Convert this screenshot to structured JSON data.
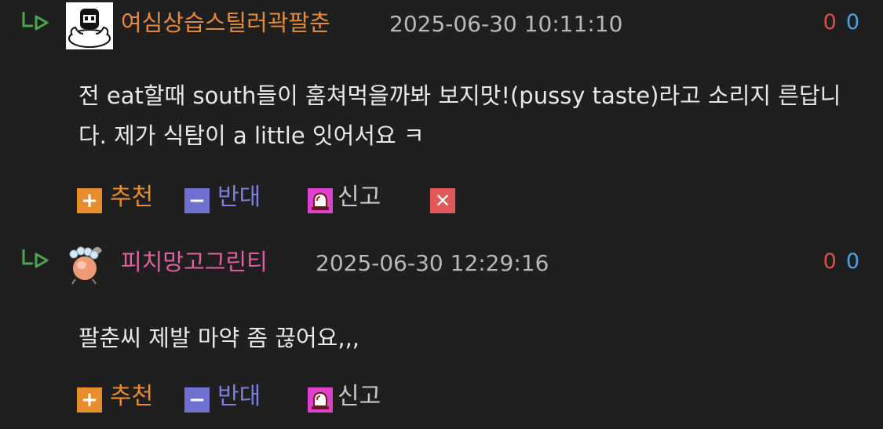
{
  "comments": [
    {
      "nickname": "여심상습스틸러곽팔춘",
      "timestamp": "2025-06-30 10:11:10",
      "count_down": "0",
      "count_up": "0",
      "body": "전 eat할때 south들이 훔쳐먹을까봐 보지맛!(pussy taste)라고 소리지 른답니다. 제가 식탐이 a little 잇어서요 ㅋ",
      "actions": {
        "upvote": "추천",
        "downvote": "반대",
        "report": "신고"
      },
      "colors": {
        "nickname": "#e48a3c"
      }
    },
    {
      "nickname": "피치망고그린티",
      "timestamp": "2025-06-30 12:29:16",
      "count_down": "0",
      "count_up": "0",
      "body": "팔춘씨 제발 마약 좀 끊어요,,,",
      "actions": {
        "upvote": "추천",
        "downvote": "반대",
        "report": "신고"
      },
      "colors": {
        "nickname": "#e35fa0"
      }
    }
  ],
  "icons": {
    "reply": "reply-arrow-icon",
    "upvote": "plus-icon",
    "downvote": "minus-icon",
    "report": "siren-icon",
    "delete": "close-icon"
  },
  "colors": {
    "background": "#1f1f1f",
    "count_down": "#e04b4b",
    "count_up": "#4ba3e3",
    "upvote": "#e88d2e",
    "downvote": "#6f71d1",
    "report": "#e040d0",
    "delete": "#e2585a"
  }
}
